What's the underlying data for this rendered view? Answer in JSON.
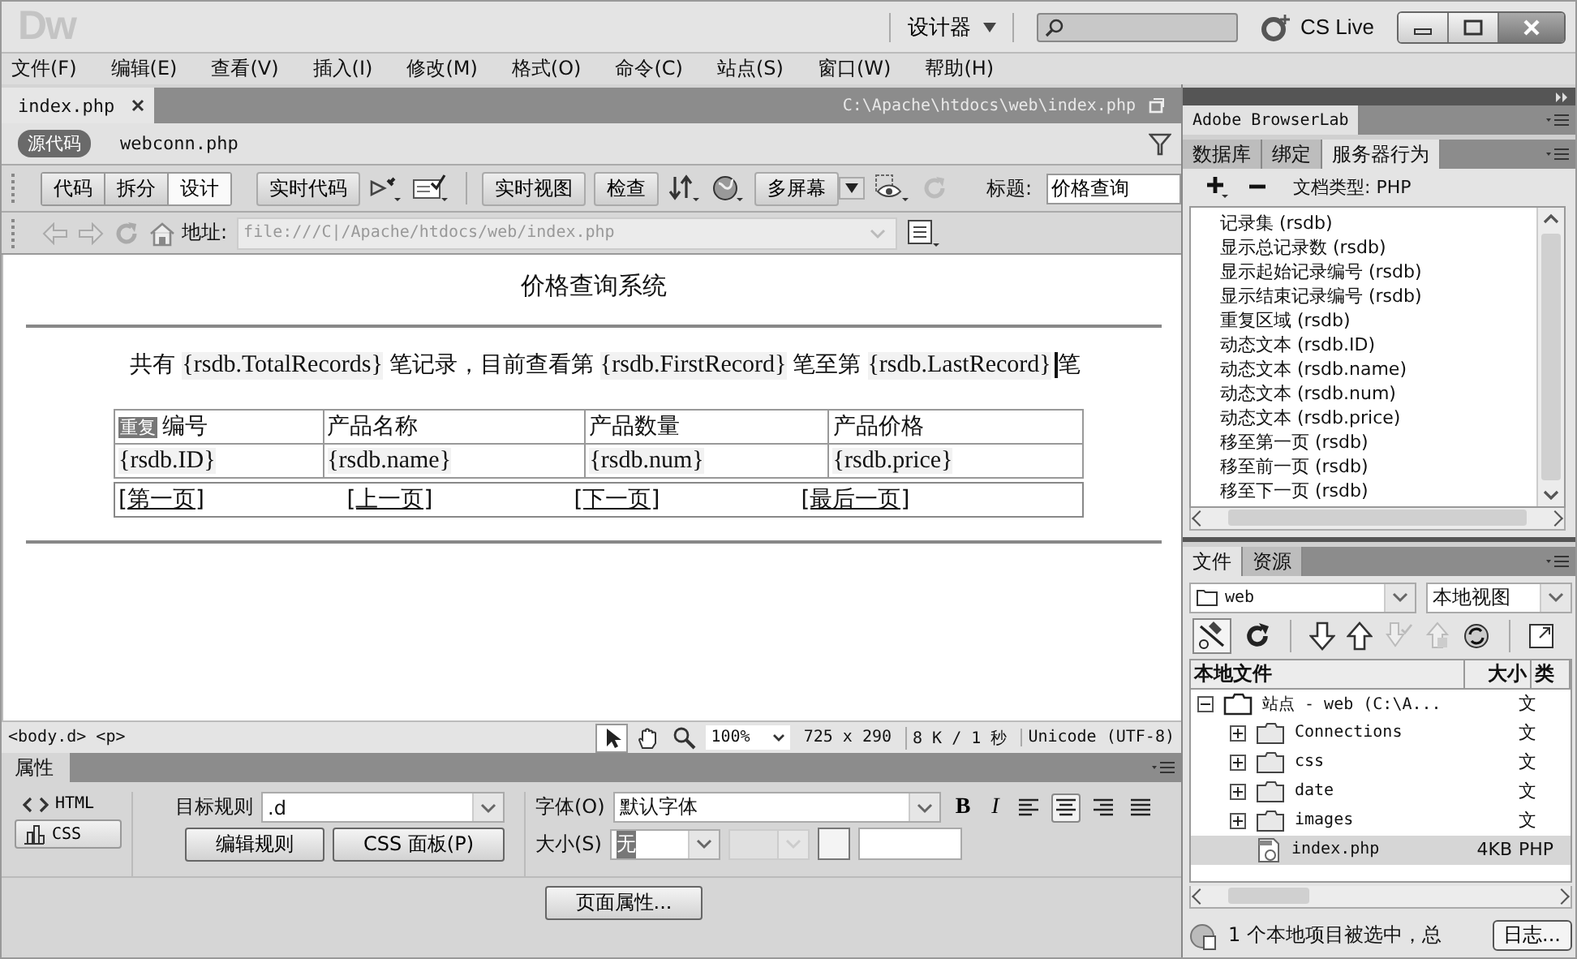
{
  "titlebar": {
    "logo": "Dw",
    "workspace": "设计器",
    "cs_live": "CS Live"
  },
  "menu": [
    "文件(F)",
    "编辑(E)",
    "查看(V)",
    "插入(I)",
    "修改(M)",
    "格式(O)",
    "命令(C)",
    "站点(S)",
    "窗口(W)",
    "帮助(H)"
  ],
  "document": {
    "tab": "index.php",
    "path": "C:\\Apache\\htdocs\\web\\index.php",
    "related_files": [
      {
        "label": "源代码",
        "selected": true
      },
      {
        "label": "webconn.php",
        "selected": false
      }
    ],
    "view_buttons": [
      {
        "label": "代码",
        "selected": false
      },
      {
        "label": "拆分",
        "selected": false
      },
      {
        "label": "设计",
        "selected": true
      }
    ],
    "live_code": "实时代码",
    "live_view": "实时视图",
    "inspect": "检查",
    "multiscreen": "多屏幕",
    "title_label": "标题:",
    "title_value": "价格查询",
    "address_label": "地址:",
    "address": "file:///C|/Apache/htdocs/web/index.php"
  },
  "page": {
    "heading": "价格查询系统",
    "summary": [
      {
        "kind": "text",
        "text": "共有"
      },
      {
        "kind": "field",
        "text": "{rsdb.TotalRecords}"
      },
      {
        "kind": "text",
        "text": "笔记录，目前查看第"
      },
      {
        "kind": "field",
        "text": "{rsdb.FirstRecord}"
      },
      {
        "kind": "text",
        "text": "笔至第"
      },
      {
        "kind": "field",
        "text": "{rsdb.LastRecord}"
      },
      {
        "kind": "text",
        "text": "笔"
      }
    ],
    "repeat_tag": "重复",
    "columns": [
      "编号",
      "产品名称",
      "产品数量",
      "产品价格"
    ],
    "rows": [
      [
        "{rsdb.ID}",
        "{rsdb.name}",
        "{rsdb.num}",
        "{rsdb.price}"
      ]
    ],
    "nav_links": [
      "[第一页]",
      "[上一页]",
      "[下一页]",
      "[最后一页]"
    ]
  },
  "status_bar": {
    "tags": "<body.d> <p>",
    "zoom": "100%",
    "size": "725 x 290",
    "speed": "8 K / 1 秒",
    "encoding": "Unicode (UTF-8)"
  },
  "properties": {
    "title": "属性",
    "modes": [
      {
        "label": "HTML",
        "selected": false
      },
      {
        "label": "CSS",
        "selected": true
      }
    ],
    "target_rule_label": "目标规则",
    "target_rule": ".d",
    "edit_rule": "编辑规则",
    "css_panel": "CSS 面板(P)",
    "font_label": "字体(O)",
    "font": "默认字体",
    "size_label": "大小(S)",
    "size": "无",
    "format_buttons": [
      "B",
      "I"
    ],
    "align": [
      {
        "kind": "left",
        "selected": false
      },
      {
        "kind": "center",
        "selected": true
      },
      {
        "kind": "right",
        "selected": false
      },
      {
        "kind": "justify",
        "selected": false
      }
    ],
    "page_properties": "页面属性..."
  },
  "browserlab": "Adobe BrowserLab",
  "behaviors_panel": {
    "tabs": [
      {
        "label": "数据库",
        "selected": false
      },
      {
        "label": "绑定",
        "selected": false
      },
      {
        "label": "服务器行为",
        "selected": true
      }
    ],
    "doc_type": "文档类型: PHP",
    "items": [
      "记录集 (rsdb)",
      "显示总记录数 (rsdb)",
      "显示起始记录编号 (rsdb)",
      "显示结束记录编号 (rsdb)",
      "重复区域 (rsdb)",
      "动态文本 (rsdb.ID)",
      "动态文本 (rsdb.name)",
      "动态文本 (rsdb.num)",
      "动态文本 (rsdb.price)",
      "移至第一页 (rsdb)",
      "移至前一页 (rsdb)",
      "移至下一页 (rsdb)"
    ]
  },
  "files_panel": {
    "tabs": [
      {
        "label": "文件",
        "selected": true
      },
      {
        "label": "资源",
        "selected": false
      }
    ],
    "site": "web",
    "view": "本地视图",
    "columns": [
      "本地文件",
      "大小",
      "类"
    ],
    "tree": [
      {
        "kind": "site",
        "name": "站点 - web (C:\\A...",
        "type": "文",
        "expanded": true,
        "selected": false,
        "children": [
          {
            "kind": "folder",
            "name": "Connections",
            "type": "文",
            "expanded": false,
            "selected": false
          },
          {
            "kind": "folder",
            "name": "css",
            "type": "文",
            "expanded": false,
            "selected": false
          },
          {
            "kind": "folder",
            "name": "date",
            "type": "文",
            "expanded": false,
            "selected": false
          },
          {
            "kind": "folder",
            "name": "images",
            "type": "文",
            "expanded": false,
            "selected": false
          },
          {
            "kind": "file",
            "name": "index.php",
            "size": "4KB",
            "type": "PHP",
            "selected": true
          }
        ]
      }
    ],
    "status": "1 个本地项目被选中，总",
    "log_button": "日志..."
  }
}
